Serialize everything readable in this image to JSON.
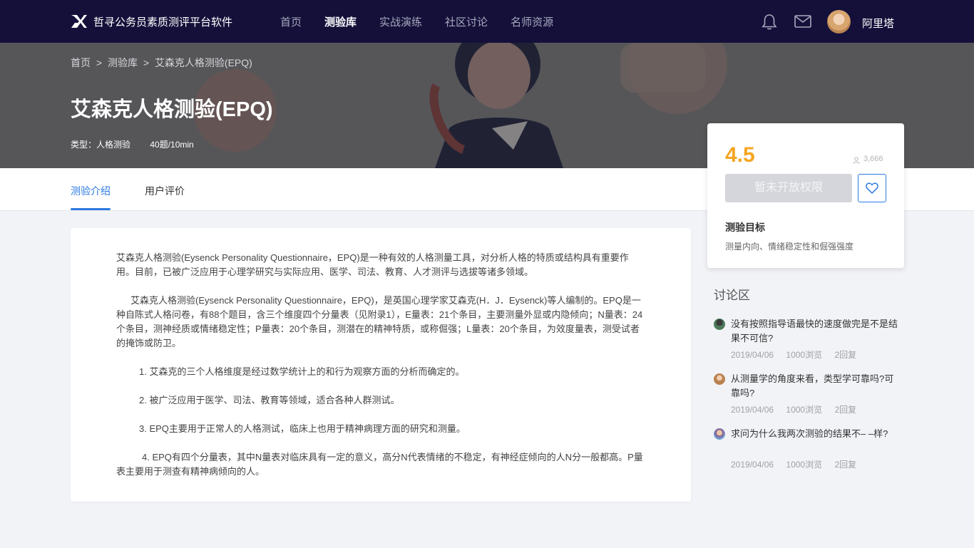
{
  "header": {
    "brand": "哲寻公务员素质测评平台软件",
    "nav": [
      "首页",
      "测验库",
      "实战演练",
      "社区讨论",
      "名师资源"
    ],
    "active_nav": "测验库",
    "username": "阿里塔"
  },
  "banner": {
    "breadcrumb": [
      "首页",
      ">",
      "测验库",
      ">",
      "艾森克人格测验(EPQ)"
    ],
    "title": "艾森克人格测验(EPQ)",
    "type_label": "类型：人格测验",
    "duration": "40题/10min"
  },
  "tabs": [
    "测验介绍",
    "用户评价"
  ],
  "content": {
    "paragraphs": [
      "艾森克人格测验(Eysenck Personality Questionnaire，EPQ)是一种有效的人格测量工具，对分析人格的特质或结构具有重要作用。目前，已被广泛应用于心理学研究与实际应用、医学、司法、教育、人才测评与选拔等诸多领域。",
      "艾森克人格测验(Eysenck Personality Questionnaire，EPQ)，是英国心理学家艾森克(H．J．Eysenck)等人编制的。EPQ是一种自陈式人格问卷，有88个题目，含三个维度四个分量表（见附录1），E量表：21个条目，主要测量外显或内隐倾向；N量表：24个条目，测神经质或情绪稳定性；P量表：20个条目，测潜在的精神特质，或称倔强；L量表：20个条目，为效度量表，测受试者的掩饰或防卫。",
      "1. 艾森克的三个人格维度是经过数学统计上的和行为观察方面的分析而确定的。",
      "2. 被广泛应用于医学、司法、教育等领域，适合各种人群测试。",
      "3. EPQ主要用于正常人的人格测试，临床上也用于精神病理方面的研究和测量。",
      "4. EPQ有四个分量表，其中N量表对临床具有一定的意义，高分N代表情绪的不稳定，有神经症倾向的人N分一般都高。P量表主要用于测查有精神病倾向的人。"
    ]
  },
  "rating": {
    "score": "4.5",
    "users": "3,666",
    "access_button": "暂未开放权限",
    "goal_heading": "测验目标",
    "goal_text": "测量内向、情绪稳定性和倔强强度"
  },
  "discussion": {
    "heading": "讨论区",
    "items": [
      {
        "question": "没有按照指导语最快的速度做完是不是结果不可信?",
        "date": "2019/04/06",
        "views": "1000浏览",
        "replies": "2回复"
      },
      {
        "question": "从测量学的角度来看，类型学可靠吗?可靠吗?",
        "date": "2019/04/06",
        "views": "1000浏览",
        "replies": "2回复"
      },
      {
        "question": "求问为什么我两次测验的结果不–  –样?",
        "date": "2019/04/06",
        "views": "1000浏览",
        "replies": "2回复"
      }
    ]
  },
  "colors": {
    "topbar": "#14103a",
    "accent": "#2d7ae0",
    "score": "#f5a623"
  }
}
